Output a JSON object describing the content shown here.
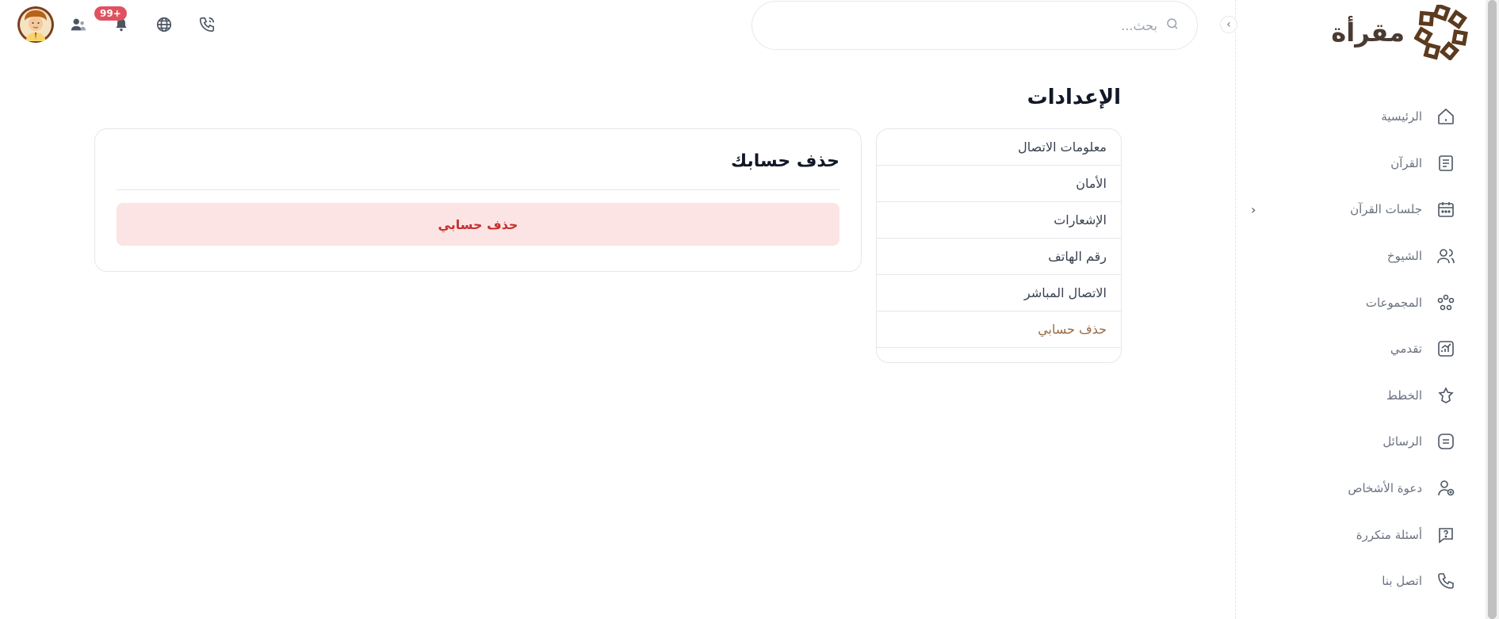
{
  "brand": {
    "name": "مقرأة",
    "color": "#5b3a1e"
  },
  "search": {
    "placeholder": "بحث..."
  },
  "notifications": {
    "badge": "+99"
  },
  "nav": {
    "items": [
      {
        "label": "الرئيسية",
        "icon": "home-icon"
      },
      {
        "label": "القرآن",
        "icon": "book-icon"
      },
      {
        "label": "جلسات القرآن",
        "icon": "calendar-icon",
        "expandable": true
      },
      {
        "label": "الشيوخ",
        "icon": "users-icon"
      },
      {
        "label": "المجموعات",
        "icon": "groups-icon"
      },
      {
        "label": "تقدمي",
        "icon": "chart-icon"
      },
      {
        "label": "الخطط",
        "icon": "star-icon"
      },
      {
        "label": "الرسائل",
        "icon": "message-icon"
      },
      {
        "label": "دعوة الأشخاص",
        "icon": "user-plus-icon"
      },
      {
        "label": "أسئلة متكررة",
        "icon": "question-icon"
      },
      {
        "label": "اتصل بنا",
        "icon": "phone-icon"
      }
    ]
  },
  "page": {
    "title": "الإعدادات"
  },
  "settings_menu": {
    "items": [
      {
        "label": "معلومات الاتصال"
      },
      {
        "label": "الأمان"
      },
      {
        "label": "الإشعارات"
      },
      {
        "label": "رقم الهاتف"
      },
      {
        "label": "الاتصال المباشر"
      },
      {
        "label": "حذف حسابي",
        "active": true
      }
    ]
  },
  "delete_card": {
    "title": "حذف حسابك",
    "button_label": "حذف حسابي"
  },
  "colors": {
    "accent": "#9a6a42",
    "danger_bg": "#fce4e4",
    "danger_text": "#c53030",
    "badge": "#e05260"
  }
}
